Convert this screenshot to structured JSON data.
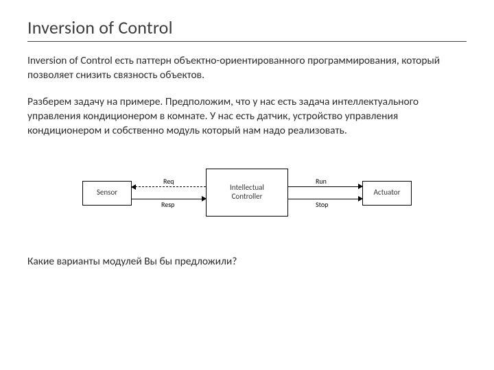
{
  "title": "Inversion of Control",
  "para1": "Inversion of Control есть паттерн объектно-ориентированного программирования, который позволяет снизить связность объектов.",
  "para2": "Разберем задачу на примере. Предположим, что у нас есть задача интеллектуального управления кондиционером в комнате. У нас есть датчик, устройство управления кондиционером и собственно модуль который нам надо реализовать.",
  "question": "Какие варианты модулей Вы бы предложили?",
  "diagram": {
    "nodes": {
      "sensor": "Sensor",
      "controller": "Intellectual\nController",
      "actuator": "Actuator"
    },
    "edges": {
      "req": "Req",
      "resp": "Resp",
      "run": "Run",
      "stop": "Stop"
    }
  }
}
